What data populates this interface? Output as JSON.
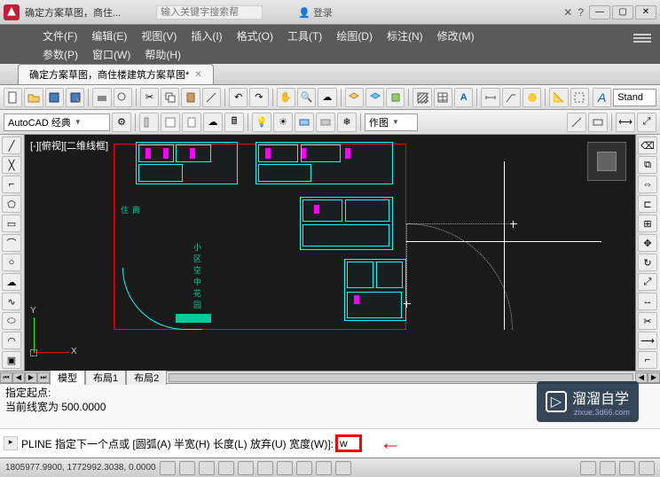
{
  "title_bar": {
    "doc_title_fragment": "确定方案草图，商住...",
    "search_placeholder": "输入关键字搜索帮",
    "login_text": "登录",
    "login_icon_glyph": "👤"
  },
  "menus": {
    "row1": [
      {
        "label": "文件(F)"
      },
      {
        "label": "编辑(E)"
      },
      {
        "label": "视图(V)"
      },
      {
        "label": "插入(I)"
      },
      {
        "label": "格式(O)"
      },
      {
        "label": "工具(T)"
      },
      {
        "label": "绘图(D)"
      },
      {
        "label": "标注(N)"
      },
      {
        "label": "修改(M)"
      }
    ],
    "row2": [
      {
        "label": "参数(P)"
      },
      {
        "label": "窗口(W)"
      },
      {
        "label": "帮助(H)"
      }
    ]
  },
  "doc_tab": {
    "label": "确定方案草图，商住楼建筑方案草图*"
  },
  "toolbar1_icons": [
    "new",
    "open",
    "save",
    "saveas",
    "print",
    "print-preview",
    "cut",
    "copy",
    "paste",
    "match",
    "undo",
    "redo",
    "link",
    "cloud",
    "publish",
    "layer",
    "layer-prop",
    "block",
    "hatch",
    "table",
    "text",
    "dim",
    "mleader",
    "render",
    "a-icon",
    "standard-combo"
  ],
  "workspace_combo": {
    "label": "AutoCAD 经典"
  },
  "drawing_tool_combo": {
    "label": "作图"
  },
  "viewport": {
    "label": "[-][俯视][二维线框]",
    "ucs_x": "X",
    "ucs_y": "Y",
    "center_label": "小区空中花园"
  },
  "layout_tabs": {
    "model": "模型",
    "layout1": "布局1",
    "layout2": "布局2"
  },
  "command": {
    "history_line1": "指定起点:",
    "history_line2": "当前线宽为 500.0000",
    "prompt_prefix": "PLINE 指定下一个点或 [",
    "options": "圆弧(A) 半宽(H) 长度(L) 放弃(U) 宽度(W)",
    "prompt_suffix": "]: ",
    "input_value": "w"
  },
  "status": {
    "coords": "1805977.9900, 1772992.3038, 0.0000"
  },
  "watermark": {
    "name": "溜溜自学",
    "url": "zixue.3d66.com",
    "play_glyph": "▷"
  },
  "right_tool_a": "A",
  "standard_label": "Stand"
}
